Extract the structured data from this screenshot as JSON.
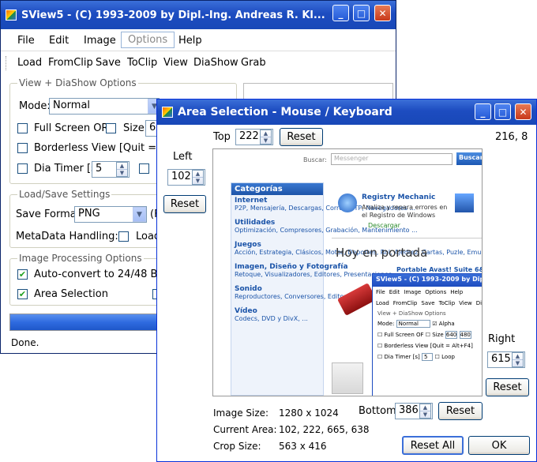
{
  "main": {
    "title": "SView5 - (C) 1993-2009 by Dipl.-Ing. Andreas R. Kl...",
    "menu": [
      "File",
      "Edit",
      "Image",
      "Options",
      "Help"
    ],
    "toolbar": [
      "Load",
      "FromClip",
      "Save",
      "ToClip",
      "View",
      "DiaShow",
      "Grab"
    ],
    "viewgrp": {
      "title": "View + DiaShow Options",
      "mode_label": "Mode:",
      "mode_value": "Normal",
      "fullscreen": "Full Screen OR",
      "size": "Size",
      "size_value": "6",
      "borderless": "Borderless View [Quit = Alt+F",
      "diatimer": "Dia Timer [s]",
      "diatimer_value": "5"
    },
    "loadgrp": {
      "title": "Load/Save Settings",
      "format_label": "Save Format:",
      "format_value": "PNG",
      "format2": "(F",
      "metadata": "MetaData Handling:",
      "load": "Load"
    },
    "imggrp": {
      "title": "Image Processing Options",
      "autoconvert": "Auto-convert to 24/48 Bit",
      "area": "Area Selection"
    },
    "status": "Done."
  },
  "area": {
    "title": "Area Selection - Mouse / Keyboard",
    "top_label": "Top",
    "top_value": "222",
    "reset": "Reset",
    "coords": "216, 8",
    "left_label": "Left",
    "left_value": "102",
    "right_label": "Right",
    "right_value": "615",
    "bottom_label": "Bottom",
    "bottom_value": "386",
    "image_size_label": "Image Size:",
    "image_size": "1280 x 1024",
    "current_area_label": "Current Area:",
    "current_area": "102, 222, 665, 638",
    "crop_size_label": "Crop Size:",
    "crop_size": "563 x 416",
    "reset_all": "Reset All",
    "ok": "OK"
  },
  "preview": {
    "search_label": "Buscar:",
    "search_placeholder": "Messenger",
    "search_btn": "Buscar",
    "categories_title": "Categorías",
    "categories": [
      {
        "name": "Internet",
        "desc": "P2P, Mensajería, Descargas, Correo, FTP, Navegadores ..."
      },
      {
        "name": "Utilidades",
        "desc": "Optimización, Compresores, Grabación, Mantenimiento ..."
      },
      {
        "name": "Juegos",
        "desc": "Acción, Estrategia, Clásicos, Motor, Deportes, Rol, Ajedrez, Cartas, Puzle, Emuladores ..."
      },
      {
        "name": "Imagen, Diseño y Fotografía",
        "desc": "Retoque, Visualizadores, Editores, Presentaciones ..."
      },
      {
        "name": "Sonido",
        "desc": "Reproductores, Conversores, Editores, Mezcladores ..."
      },
      {
        "name": "Vídeo",
        "desc": "Codecs, DVD y DivX, ..."
      }
    ],
    "app_title": "Registry Mechanic",
    "app_desc": "Analiza y repara errores en el Registro de Windows",
    "download": "Descargar",
    "headline": "Hoy en portada",
    "headline2": "Portable Avast! Suite 6&...",
    "nested": {
      "title": "SView5 - (C) 1993-2009 by Dipl. ...",
      "menu": [
        "File",
        "Edit",
        "Image",
        "Options",
        "Help"
      ],
      "toolbar": [
        "Load",
        "FromClip",
        "Save",
        "ToClip",
        "View",
        "DiaSh"
      ],
      "group": "View + DiaShow Options",
      "mode": "Mode:",
      "mode_value": "Normal",
      "alpha": "Alpha",
      "fullscreen": "Full Screen OF",
      "size": "Size",
      "v1": "640",
      "v2": "480",
      "borderless": "Borderless View [Quit = Alt+F4]",
      "diatimer": "Dia Timer [s]",
      "diatimer_value": "5",
      "loop": "Loop"
    }
  }
}
